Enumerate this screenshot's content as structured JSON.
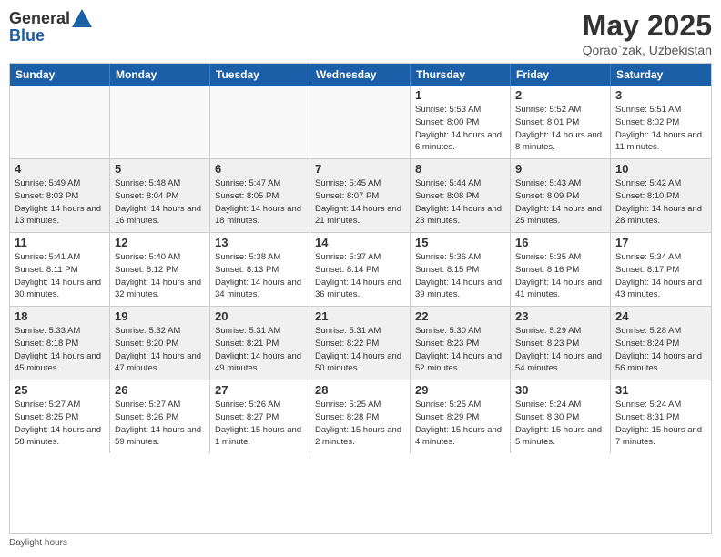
{
  "logo": {
    "general": "General",
    "blue": "Blue"
  },
  "title": "May 2025",
  "location": "Qorao`zak, Uzbekistan",
  "days_of_week": [
    "Sunday",
    "Monday",
    "Tuesday",
    "Wednesday",
    "Thursday",
    "Friday",
    "Saturday"
  ],
  "weeks": [
    [
      {
        "day": "",
        "empty": true
      },
      {
        "day": "",
        "empty": true
      },
      {
        "day": "",
        "empty": true
      },
      {
        "day": "",
        "empty": true
      },
      {
        "day": "1",
        "sunrise": "5:53 AM",
        "sunset": "8:00 PM",
        "daylight": "14 hours and 6 minutes."
      },
      {
        "day": "2",
        "sunrise": "5:52 AM",
        "sunset": "8:01 PM",
        "daylight": "14 hours and 8 minutes."
      },
      {
        "day": "3",
        "sunrise": "5:51 AM",
        "sunset": "8:02 PM",
        "daylight": "14 hours and 11 minutes."
      }
    ],
    [
      {
        "day": "4",
        "sunrise": "5:49 AM",
        "sunset": "8:03 PM",
        "daylight": "14 hours and 13 minutes."
      },
      {
        "day": "5",
        "sunrise": "5:48 AM",
        "sunset": "8:04 PM",
        "daylight": "14 hours and 16 minutes."
      },
      {
        "day": "6",
        "sunrise": "5:47 AM",
        "sunset": "8:05 PM",
        "daylight": "14 hours and 18 minutes."
      },
      {
        "day": "7",
        "sunrise": "5:45 AM",
        "sunset": "8:07 PM",
        "daylight": "14 hours and 21 minutes."
      },
      {
        "day": "8",
        "sunrise": "5:44 AM",
        "sunset": "8:08 PM",
        "daylight": "14 hours and 23 minutes."
      },
      {
        "day": "9",
        "sunrise": "5:43 AM",
        "sunset": "8:09 PM",
        "daylight": "14 hours and 25 minutes."
      },
      {
        "day": "10",
        "sunrise": "5:42 AM",
        "sunset": "8:10 PM",
        "daylight": "14 hours and 28 minutes."
      }
    ],
    [
      {
        "day": "11",
        "sunrise": "5:41 AM",
        "sunset": "8:11 PM",
        "daylight": "14 hours and 30 minutes."
      },
      {
        "day": "12",
        "sunrise": "5:40 AM",
        "sunset": "8:12 PM",
        "daylight": "14 hours and 32 minutes."
      },
      {
        "day": "13",
        "sunrise": "5:38 AM",
        "sunset": "8:13 PM",
        "daylight": "14 hours and 34 minutes."
      },
      {
        "day": "14",
        "sunrise": "5:37 AM",
        "sunset": "8:14 PM",
        "daylight": "14 hours and 36 minutes."
      },
      {
        "day": "15",
        "sunrise": "5:36 AM",
        "sunset": "8:15 PM",
        "daylight": "14 hours and 39 minutes."
      },
      {
        "day": "16",
        "sunrise": "5:35 AM",
        "sunset": "8:16 PM",
        "daylight": "14 hours and 41 minutes."
      },
      {
        "day": "17",
        "sunrise": "5:34 AM",
        "sunset": "8:17 PM",
        "daylight": "14 hours and 43 minutes."
      }
    ],
    [
      {
        "day": "18",
        "sunrise": "5:33 AM",
        "sunset": "8:18 PM",
        "daylight": "14 hours and 45 minutes."
      },
      {
        "day": "19",
        "sunrise": "5:32 AM",
        "sunset": "8:20 PM",
        "daylight": "14 hours and 47 minutes."
      },
      {
        "day": "20",
        "sunrise": "5:31 AM",
        "sunset": "8:21 PM",
        "daylight": "14 hours and 49 minutes."
      },
      {
        "day": "21",
        "sunrise": "5:31 AM",
        "sunset": "8:22 PM",
        "daylight": "14 hours and 50 minutes."
      },
      {
        "day": "22",
        "sunrise": "5:30 AM",
        "sunset": "8:23 PM",
        "daylight": "14 hours and 52 minutes."
      },
      {
        "day": "23",
        "sunrise": "5:29 AM",
        "sunset": "8:23 PM",
        "daylight": "14 hours and 54 minutes."
      },
      {
        "day": "24",
        "sunrise": "5:28 AM",
        "sunset": "8:24 PM",
        "daylight": "14 hours and 56 minutes."
      }
    ],
    [
      {
        "day": "25",
        "sunrise": "5:27 AM",
        "sunset": "8:25 PM",
        "daylight": "14 hours and 58 minutes."
      },
      {
        "day": "26",
        "sunrise": "5:27 AM",
        "sunset": "8:26 PM",
        "daylight": "14 hours and 59 minutes."
      },
      {
        "day": "27",
        "sunrise": "5:26 AM",
        "sunset": "8:27 PM",
        "daylight": "15 hours and 1 minute."
      },
      {
        "day": "28",
        "sunrise": "5:25 AM",
        "sunset": "8:28 PM",
        "daylight": "15 hours and 2 minutes."
      },
      {
        "day": "29",
        "sunrise": "5:25 AM",
        "sunset": "8:29 PM",
        "daylight": "15 hours and 4 minutes."
      },
      {
        "day": "30",
        "sunrise": "5:24 AM",
        "sunset": "8:30 PM",
        "daylight": "15 hours and 5 minutes."
      },
      {
        "day": "31",
        "sunrise": "5:24 AM",
        "sunset": "8:31 PM",
        "daylight": "15 hours and 7 minutes."
      }
    ]
  ],
  "footer": {
    "daylight_label": "Daylight hours"
  }
}
